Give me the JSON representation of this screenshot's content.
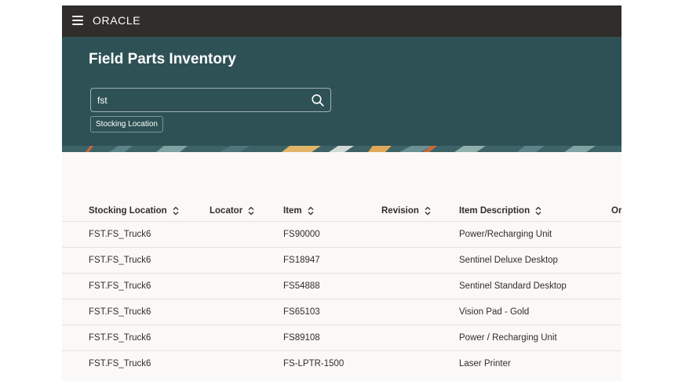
{
  "header": {
    "logo_text": "ORACLE"
  },
  "hero": {
    "title": "Field Parts Inventory",
    "search": {
      "value": "fst",
      "placeholder": ""
    },
    "filter_chip": "Stocking Location"
  },
  "table": {
    "columns": [
      {
        "label": "Stocking Location",
        "sortable": true
      },
      {
        "label": "Locator",
        "sortable": true
      },
      {
        "label": "Item",
        "sortable": true
      },
      {
        "label": "Revision",
        "sortable": true
      },
      {
        "label": "Item Description",
        "sortable": true
      },
      {
        "label": "Or",
        "sortable": false
      }
    ],
    "rows": [
      {
        "stocking_location": "FST.FS_Truck6",
        "locator": "",
        "item": "FS90000",
        "revision": "",
        "description": "Power/Recharging Unit"
      },
      {
        "stocking_location": "FST.FS_Truck6",
        "locator": "",
        "item": "FS18947",
        "revision": "",
        "description": "Sentinel Deluxe Desktop"
      },
      {
        "stocking_location": "FST.FS_Truck6",
        "locator": "",
        "item": "FS54888",
        "revision": "",
        "description": "Sentinel Standard Desktop"
      },
      {
        "stocking_location": "FST.FS_Truck6",
        "locator": "",
        "item": "FS65103",
        "revision": "",
        "description": "Vision Pad - Gold"
      },
      {
        "stocking_location": "FST.FS_Truck6",
        "locator": "",
        "item": "FS89108",
        "revision": "",
        "description": "Power / Recharging Unit"
      },
      {
        "stocking_location": "FST.FS_Truck6",
        "locator": "",
        "item": "FS-LPTR-1500",
        "revision": "",
        "description": "Laser Printer"
      }
    ]
  },
  "icons": {
    "menu": "hamburger-menu-icon",
    "search": "search-icon",
    "sort": "sort-arrows-icon"
  },
  "colors": {
    "topbar": "#312d2a",
    "hero": "#2e5155",
    "content_bg": "#faf9f7",
    "text": "#312d2a",
    "divider": "#e6e3df"
  }
}
